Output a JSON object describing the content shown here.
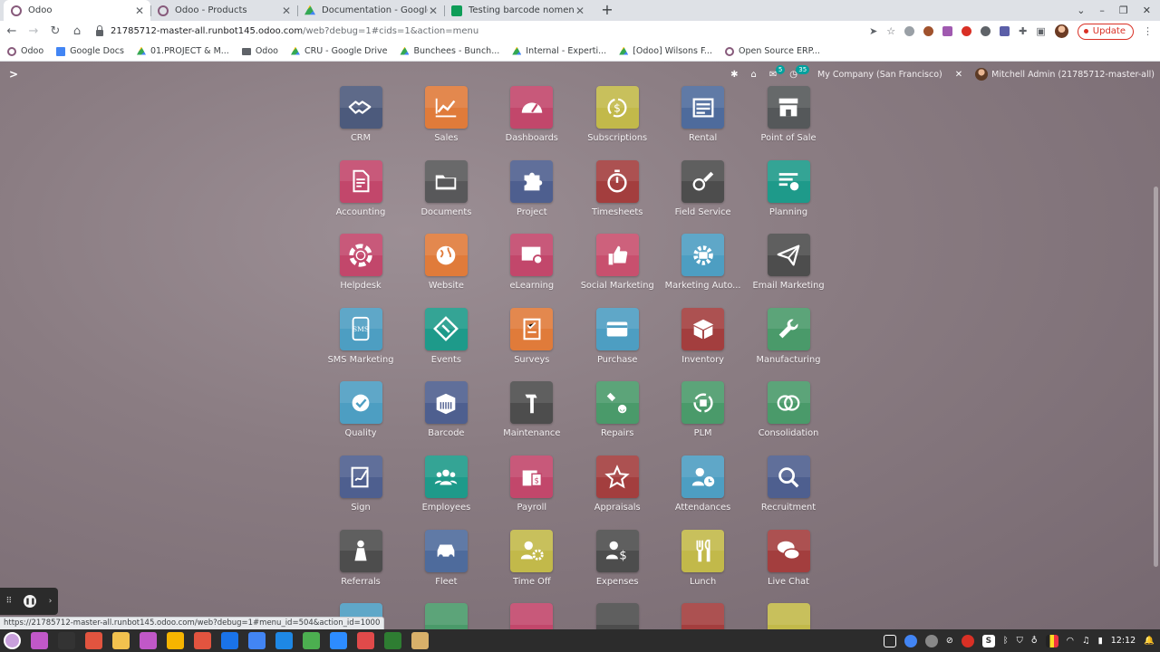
{
  "browser": {
    "tabs": [
      {
        "title": "Odoo",
        "favicon": "odoo",
        "active": true
      },
      {
        "title": "Odoo - Products",
        "favicon": "odoo",
        "active": false
      },
      {
        "title": "Documentation - Google Drive",
        "favicon": "drive",
        "active": false
      },
      {
        "title": "Testing barcode nomenclature",
        "favicon": "sheets",
        "active": false
      }
    ],
    "url_host": "21785712-master-all.runbot145.odoo.com",
    "url_path": "/web?debug=1#cids=1&action=menu",
    "update_label": "Update",
    "bookmarks": [
      {
        "label": "Odoo",
        "icon": "odoo"
      },
      {
        "label": "Google Docs",
        "icon": "docs"
      },
      {
        "label": "01.PROJECT & M...",
        "icon": "drive"
      },
      {
        "label": "Odoo",
        "icon": "folder"
      },
      {
        "label": "CRU - Google Drive",
        "icon": "drive"
      },
      {
        "label": "Bunchees - Bunch...",
        "icon": "drive"
      },
      {
        "label": "Internal - Experti...",
        "icon": "drive"
      },
      {
        "label": "[Odoo] Wilsons F...",
        "icon": "drive"
      },
      {
        "label": "Open Source ERP...",
        "icon": "odoo"
      }
    ]
  },
  "odoo": {
    "systray": {
      "messages_count": "5",
      "activities_count": "35",
      "company": "My Company (San Francisco)",
      "user": "Mitchell Admin (21785712-master-all)"
    },
    "apps": [
      {
        "label": "CRM",
        "icon": "handshake-icon",
        "color": "#4c5a7c"
      },
      {
        "label": "Sales",
        "icon": "trend-chart-icon",
        "color": "#e07b3a"
      },
      {
        "label": "Dashboards",
        "icon": "gauge-icon",
        "color": "#c2476b"
      },
      {
        "label": "Subscriptions",
        "icon": "recurring-dollar-icon",
        "color": "#c2b94a"
      },
      {
        "label": "Rental",
        "icon": "calendar-list-icon",
        "color": "#4e6b9c"
      },
      {
        "label": "Point of Sale",
        "icon": "store-icon",
        "color": "#55585a"
      },
      {
        "label": "Accounting",
        "icon": "invoice-icon",
        "color": "#c2476b"
      },
      {
        "label": "Documents",
        "icon": "folder-icon",
        "color": "#58585a"
      },
      {
        "label": "Project",
        "icon": "puzzle-icon",
        "color": "#4e5f8f"
      },
      {
        "label": "Timesheets",
        "icon": "stopwatch-icon",
        "color": "#a33e3e"
      },
      {
        "label": "Field Service",
        "icon": "field-service-icon",
        "color": "#4d4d4d"
      },
      {
        "label": "Planning",
        "icon": "planning-icon",
        "color": "#1e9a8a"
      },
      {
        "label": "Helpdesk",
        "icon": "lifebuoy-icon",
        "color": "#c2476b"
      },
      {
        "label": "Website",
        "icon": "globe-icon",
        "color": "#e07b3a"
      },
      {
        "label": "eLearning",
        "icon": "elearning-icon",
        "color": "#c2476b"
      },
      {
        "label": "Social Marketing",
        "icon": "thumbs-up-icon",
        "color": "#c8506e"
      },
      {
        "label": "Marketing Auto...",
        "icon": "gear-envelope-icon",
        "color": "#4d9ec2"
      },
      {
        "label": "Email Marketing",
        "icon": "paper-plane-icon",
        "color": "#4d4d4d"
      },
      {
        "label": "SMS Marketing",
        "icon": "sms-phone-icon",
        "color": "#4d9ec2"
      },
      {
        "label": "Events",
        "icon": "ticket-icon",
        "color": "#1e9a8a"
      },
      {
        "label": "Surveys",
        "icon": "clipboard-icon",
        "color": "#e07b3a"
      },
      {
        "label": "Purchase",
        "icon": "credit-card-icon",
        "color": "#4d9ec2"
      },
      {
        "label": "Inventory",
        "icon": "box-icon",
        "color": "#a33e3e"
      },
      {
        "label": "Manufacturing",
        "icon": "wrench-icon",
        "color": "#4a9a6a"
      },
      {
        "label": "Quality",
        "icon": "quality-badge-icon",
        "color": "#4d9ec2"
      },
      {
        "label": "Barcode",
        "icon": "barcode-box-icon",
        "color": "#4e5f8f"
      },
      {
        "label": "Maintenance",
        "icon": "hammer-icon",
        "color": "#4d4d4d"
      },
      {
        "label": "Repairs",
        "icon": "repair-icon",
        "color": "#4a9a6a"
      },
      {
        "label": "PLM",
        "icon": "plm-cycle-icon",
        "color": "#4a9a6a"
      },
      {
        "label": "Consolidation",
        "icon": "consolidation-icon",
        "color": "#4a9a6a"
      },
      {
        "label": "Sign",
        "icon": "sign-icon",
        "color": "#4e5f8f"
      },
      {
        "label": "Employees",
        "icon": "people-icon",
        "color": "#1e9a8a"
      },
      {
        "label": "Payroll",
        "icon": "payroll-icon",
        "color": "#c2476b"
      },
      {
        "label": "Appraisals",
        "icon": "star-badge-icon",
        "color": "#a33e3e"
      },
      {
        "label": "Attendances",
        "icon": "user-clock-icon",
        "color": "#4d9ec2"
      },
      {
        "label": "Recruitment",
        "icon": "magnifier-icon",
        "color": "#4e5f8f"
      },
      {
        "label": "Referrals",
        "icon": "referral-icon",
        "color": "#4d4d4d"
      },
      {
        "label": "Fleet",
        "icon": "car-icon",
        "color": "#4e6b9c"
      },
      {
        "label": "Time Off",
        "icon": "user-gear-icon",
        "color": "#c2b94a"
      },
      {
        "label": "Expenses",
        "icon": "user-dollar-icon",
        "color": "#4d4d4d"
      },
      {
        "label": "Lunch",
        "icon": "cutlery-icon",
        "color": "#c2b94a"
      },
      {
        "label": "Live Chat",
        "icon": "chat-bubbles-icon",
        "color": "#a33e3e"
      }
    ],
    "partial_row_colors": [
      "#4d9ec2",
      "#4a9a6a",
      "#c2476b",
      "#4d4d4d",
      "#a33e3e",
      "#c2b94a"
    ]
  },
  "status_bar_url": "https://21785712-master-all.runbot145.odoo.com/web?debug=1#menu_id=504&action_id=1000",
  "taskbar": {
    "clock": "12:12"
  }
}
